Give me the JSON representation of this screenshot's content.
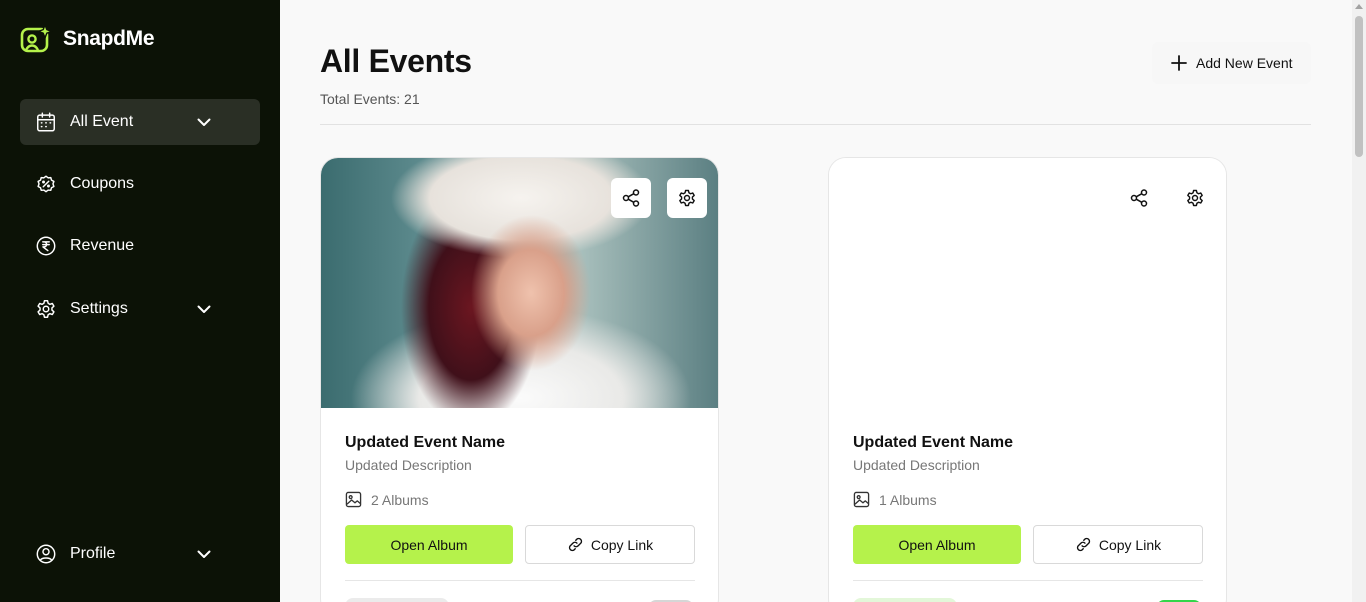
{
  "brand": {
    "name": "SnapdMe",
    "accent": "#b5f24b"
  },
  "sidebar": {
    "items": [
      {
        "label": "All Event",
        "icon": "calendar-icon",
        "active": true,
        "expandable": true
      },
      {
        "label": "Coupons",
        "icon": "coupon-badge-icon",
        "active": false,
        "expandable": false
      },
      {
        "label": "Revenue",
        "icon": "rupee-icon",
        "active": false,
        "expandable": false
      },
      {
        "label": "Settings",
        "icon": "gear-icon",
        "active": false,
        "expandable": true
      }
    ],
    "profile": {
      "label": "Profile",
      "icon": "user-circle-icon",
      "expandable": true
    }
  },
  "header": {
    "title": "All Events",
    "total_events": "Total Events: 21",
    "add_button_label": "Add New Event"
  },
  "events": [
    {
      "name": "Updated Event Name",
      "description": "Updated Description",
      "albums": "2 Albums",
      "has_cover": true,
      "open_label": "Open Album",
      "copy_label": "Copy Link"
    },
    {
      "name": "Updated Event Name",
      "description": "Updated Description",
      "albums": "1 Albums",
      "has_cover": false,
      "open_label": "Open Album",
      "copy_label": "Copy Link"
    }
  ],
  "colors": {
    "sidebar_bg": "#0c1206",
    "active_item_bg": "#2a2f25",
    "primary_button": "#b5f24b"
  }
}
